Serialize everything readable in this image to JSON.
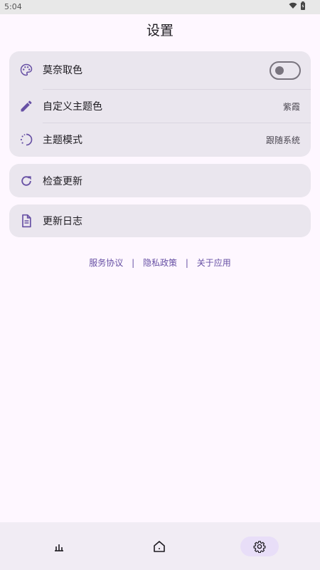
{
  "status_bar": {
    "time": "5:04"
  },
  "page": {
    "title": "设置"
  },
  "appearance": {
    "monet": {
      "label": "莫奈取色",
      "enabled": false
    },
    "custom_color": {
      "label": "自定义主题色",
      "value": "紫霞"
    },
    "theme_mode": {
      "label": "主题模式",
      "value": "跟随系统"
    }
  },
  "check_update": {
    "label": "检查更新"
  },
  "changelog": {
    "label": "更新日志"
  },
  "footer_links": {
    "service": "服务协议",
    "privacy": "隐私政策",
    "about": "关于应用",
    "separator": "|"
  },
  "bottom_nav": {
    "items": [
      {
        "icon": "stats-icon",
        "active": false
      },
      {
        "icon": "home-icon",
        "active": false
      },
      {
        "icon": "settings-icon",
        "active": true
      }
    ]
  },
  "colors": {
    "accent": "#6750A4",
    "background": "#FEF7FF",
    "card": "#EAE6EE"
  }
}
